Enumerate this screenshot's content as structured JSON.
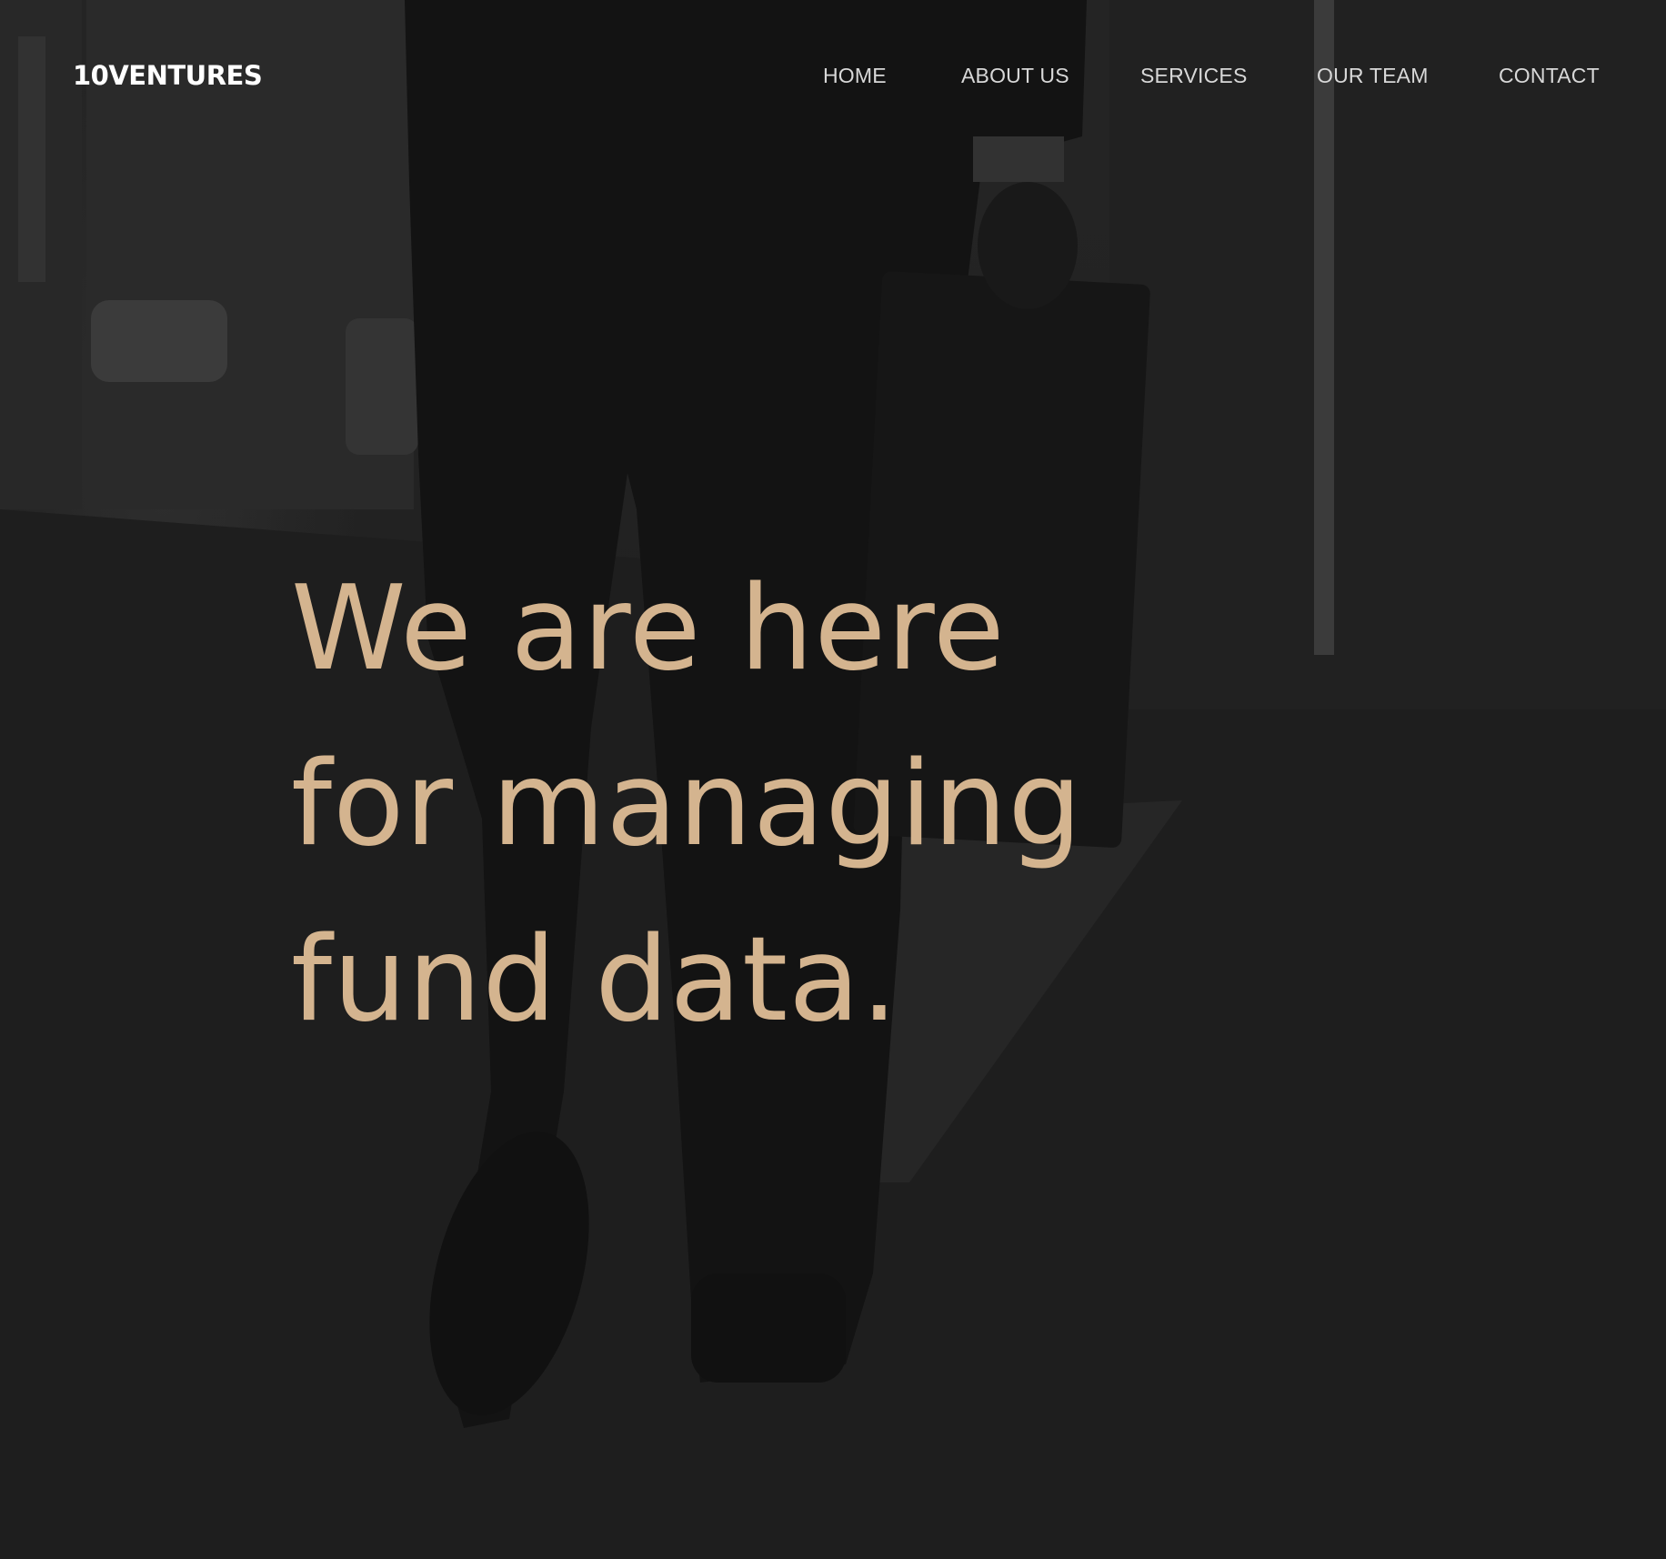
{
  "brand": {
    "logo_text": "10VENTURES"
  },
  "nav": {
    "items": [
      {
        "label": "HOME"
      },
      {
        "label": "ABOUT US"
      },
      {
        "label": "SERVICES"
      },
      {
        "label": "OUR TEAM"
      },
      {
        "label": "CONTACT"
      }
    ]
  },
  "hero": {
    "headline": "We are here for managing fund data."
  },
  "colors": {
    "background": "#1c1c1c",
    "headline": "#d4b48f",
    "logo": "#ffffff",
    "nav_text": "#d8d8d8"
  }
}
